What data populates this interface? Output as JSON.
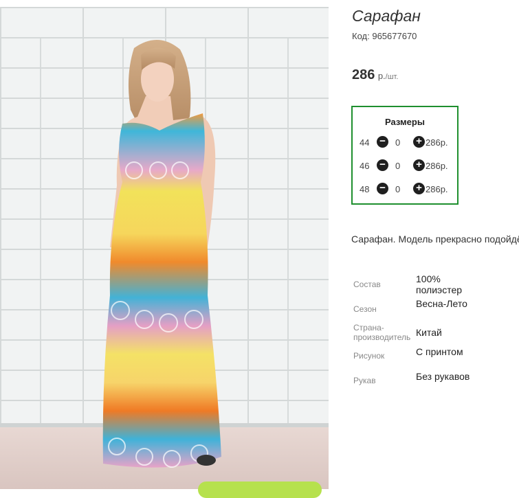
{
  "product": {
    "title": "Сарафан",
    "code_label": "Код:",
    "code_value": "965677670",
    "price_value": "286",
    "price_currency": "р.",
    "price_per": "/шт."
  },
  "sizes": {
    "title": "Размеры",
    "rows": [
      {
        "size": "44",
        "qty": "0",
        "price": "286р."
      },
      {
        "size": "46",
        "qty": "0",
        "price": "286р."
      },
      {
        "size": "48",
        "qty": "0",
        "price": "286р."
      }
    ],
    "minus_symbol": "−",
    "plus_symbol": "+"
  },
  "description": "Сарафан. Модель прекрасно подойдёт",
  "properties": [
    {
      "key": "Состав",
      "value": "100% полиэстер"
    },
    {
      "key": "Сезон",
      "value": "Весна-Лето"
    },
    {
      "key": "Страна-производитель",
      "value": "Китай"
    },
    {
      "key": "Рисунок",
      "value": "С принтом"
    },
    {
      "key": "Рукав",
      "value": "Без рукавов"
    }
  ],
  "colors": {
    "accent_border": "#1e8f2e",
    "cart_button": "#b6e14d"
  }
}
